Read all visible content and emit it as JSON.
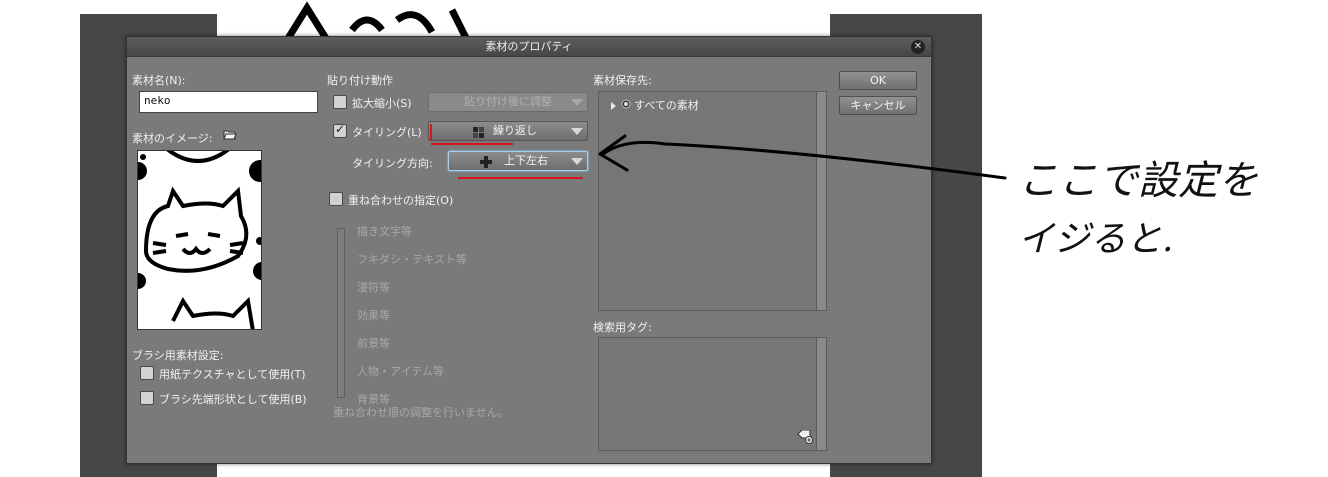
{
  "dialog": {
    "title": "素材のプロパティ",
    "ok_label": "OK",
    "cancel_label": "キャンセル"
  },
  "material_name": {
    "label": "素材名(N):",
    "value": "neko"
  },
  "material_image": {
    "label": "素材のイメージ:"
  },
  "paste_behavior": {
    "label": "貼り付け動作",
    "scale": {
      "label": "拡大縮小(S)",
      "checked": false,
      "dropdown_value": "貼り付け後に調整"
    },
    "tiling": {
      "label": "タイリング(L)",
      "checked": true,
      "dropdown_value": "繰り返し"
    },
    "tiling_direction": {
      "label": "タイリング方向:",
      "dropdown_value": "上下左右"
    }
  },
  "overlay": {
    "label": "重ね合わせの指定(O)",
    "checked": false,
    "items": [
      "描き文字等",
      "フキダシ・テキスト等",
      "漫符等",
      "効果等",
      "前景等",
      "人物・アイテム等",
      "背景等"
    ],
    "note": "重ね合わせ順の調整を行いません。"
  },
  "save_location": {
    "label": "素材保存先:",
    "tree_item": "すべての素材"
  },
  "search_tags": {
    "label": "検索用タグ:"
  },
  "brush_settings": {
    "label": "ブラシ用素材設定:",
    "paper_texture": {
      "label": "用紙テクスチャとして使用(T)",
      "checked": false
    },
    "brush_tip": {
      "label": "ブラシ先端形状として使用(B)",
      "checked": false
    }
  },
  "annotation": {
    "line1": "ここで設定を",
    "line2": "イジると."
  },
  "colors": {
    "dialog_bg": "#7a7a7a",
    "title_bg": "#4d4d4d",
    "highlight_red": "#d8141c",
    "focus_border": "#9fd3f5"
  }
}
